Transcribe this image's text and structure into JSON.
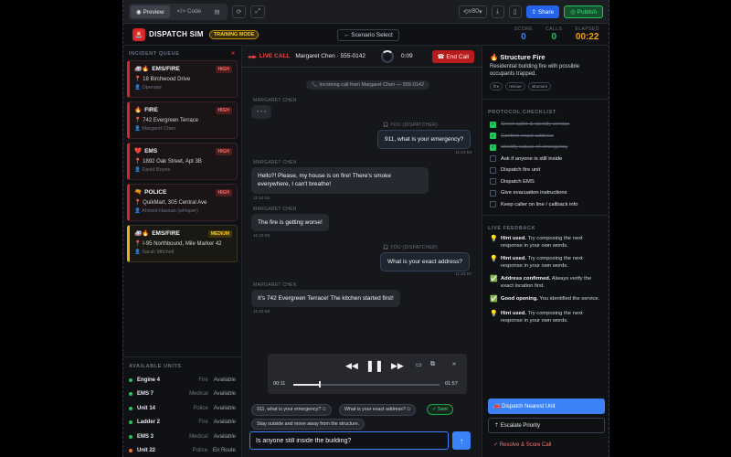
{
  "editor": {
    "preview_label": "Preview",
    "code_label": "</> Code",
    "model_label": "v80",
    "share_label": "Share",
    "publish_label": "Publish"
  },
  "header": {
    "title": "DISPATCH SIM",
    "mode": "TRAINING MODE",
    "scenario_select": "← Scenario Select",
    "stats": [
      {
        "label": "SCORE",
        "value": "0",
        "color": "#3b82f6"
      },
      {
        "label": "CALLS",
        "value": "0",
        "color": "#22c55e"
      },
      {
        "label": "ELAPSED",
        "value": "00:22",
        "color": "#f59e0b"
      }
    ]
  },
  "queue": {
    "title": "INCIDENT QUEUE",
    "items": [
      {
        "icon": "🚑🔥",
        "type": "EMS/FIRE",
        "priority": "HIGH",
        "address": "18 Birchwood Drive",
        "caller": "Operator"
      },
      {
        "icon": "🔥",
        "type": "FIRE",
        "priority": "HIGH",
        "address": "742 Evergreen Terrace",
        "caller": "Margaret Chen"
      },
      {
        "icon": "❤️",
        "type": "EMS",
        "priority": "HIGH",
        "address": "1892 Oak Street, Apt 3B",
        "caller": "David Boyes"
      },
      {
        "icon": "🔫",
        "type": "POLICE",
        "priority": "HIGH",
        "address": "QuikMart, 305 Central Ave",
        "caller": "Ahmed Hassan (whisper)"
      },
      {
        "icon": "🚑🔥",
        "type": "EMS/FIRE",
        "priority": "MEDIUM",
        "address": "I-95 Northbound, Mile Marker 42",
        "caller": "Sarah Mitchell"
      }
    ]
  },
  "units": {
    "title": "AVAILABLE UNITS",
    "items": [
      {
        "name": "Engine 4",
        "type": "Fire",
        "status": "Available"
      },
      {
        "name": "EMS 7",
        "type": "Medical",
        "status": "Available"
      },
      {
        "name": "Unit 14",
        "type": "Police",
        "status": "Available"
      },
      {
        "name": "Ladder 2",
        "type": "Fire",
        "status": "Available"
      },
      {
        "name": "EMS 3",
        "type": "Medical",
        "status": "Available"
      },
      {
        "name": "Unit 22",
        "type": "Police",
        "status": "En Route"
      }
    ]
  },
  "call": {
    "live_label": "LIVE CALL",
    "caller": "Margaret Chen · 555-0142",
    "timer": "0:09",
    "end_label": "End Call",
    "system_message": "📞 Incoming call from Margaret Chen — 555-0142"
  },
  "messages": {
    "m1": {
      "who": "MARGARET CHEN",
      "text": "• • •"
    },
    "m2": {
      "who": "🎧 YOU (DISPATCHER)",
      "text": "911, what is your emergency?",
      "time": "11:24:54"
    },
    "m3": {
      "who": "MARGARET CHEN",
      "text": "Hello?! Please, my house is on fire! There's smoke everywhere, I can't breathe!",
      "time": "11:24:54"
    },
    "m4": {
      "who": "MARGARET CHEN",
      "text": "The fire is getting worse!",
      "time": "11:24:55"
    },
    "m5": {
      "who": "🎧 YOU (DISPATCHER)",
      "text": "What is your exact address?",
      "time": "11:24:57"
    },
    "m6": {
      "who": "MARGARET CHEN",
      "text": "It's 742 Evergreen Terrace! The kitchen started first!",
      "time": "11:24:59"
    }
  },
  "player": {
    "current": "00:11",
    "total": "01:57",
    "progress": 0.18
  },
  "suggestions": {
    "s1": "911, what is your emergency?",
    "s2": "What is your exact address?",
    "s3": "✓ Sent",
    "s4": "Stay outside and move away from the structure."
  },
  "composer": {
    "value": "Is anyone still inside the building?"
  },
  "incident": {
    "title": "🔥 Structure Fire",
    "description": "Residential building fire with possible occupants trapped.",
    "tags": [
      "fire",
      "rescue",
      "structure"
    ]
  },
  "checklist": {
    "title": "PROTOCOL CHECKLIST",
    "items": [
      {
        "label": "Greet caller & identify service",
        "done": true
      },
      {
        "label": "Confirm exact address",
        "done": true
      },
      {
        "label": "Identify nature of emergency",
        "done": true
      },
      {
        "label": "Ask if anyone is still inside",
        "done": false
      },
      {
        "label": "Dispatch fire unit",
        "done": false
      },
      {
        "label": "Dispatch EMS",
        "done": false
      },
      {
        "label": "Give evacuation instructions",
        "done": false
      },
      {
        "label": "Keep caller on line / callback info",
        "done": false
      }
    ]
  },
  "feedback": {
    "title": "LIVE FEEDBACK",
    "items": [
      {
        "icon": "💡",
        "head": "Hint used.",
        "text": "Try composing the next response in your own words."
      },
      {
        "icon": "💡",
        "head": "Hint used.",
        "text": "Try composing the next response in your own words."
      },
      {
        "icon": "✅",
        "head": "Address confirmed.",
        "text": "Always verify the exact location first."
      },
      {
        "icon": "✅",
        "head": "Good opening.",
        "text": "You identified the service."
      },
      {
        "icon": "💡",
        "head": "Hint used.",
        "text": "Try composing the next response in your own words."
      }
    ]
  },
  "actions": {
    "dispatch": "🚒 Dispatch Nearest Unit",
    "escalate": "⇡ Escalate Priority",
    "resolve": "✓ Resolve & Score Call"
  }
}
